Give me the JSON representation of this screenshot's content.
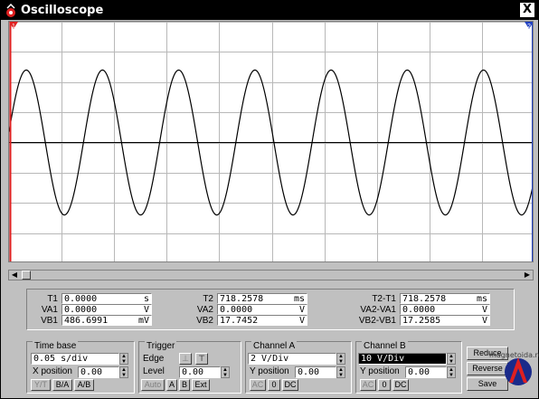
{
  "window": {
    "title": "Oscilloscope",
    "close_label": "X"
  },
  "cursors": {
    "c1": "1",
    "c2": "2"
  },
  "readout": {
    "g1": [
      {
        "label": "T1",
        "value": "0.0000",
        "unit": "s"
      },
      {
        "label": "VA1",
        "value": "0.0000",
        "unit": "V"
      },
      {
        "label": "VB1",
        "value": "486.6991",
        "unit": "mV"
      }
    ],
    "g2": [
      {
        "label": "T2",
        "value": "718.2578",
        "unit": "ms"
      },
      {
        "label": "VA2",
        "value": "0.0000",
        "unit": "V"
      },
      {
        "label": "VB2",
        "value": "17.7452",
        "unit": "V"
      }
    ],
    "g3": [
      {
        "label": "T2-T1",
        "value": "718.2578",
        "unit": "ms"
      },
      {
        "label": "VA2-VA1",
        "value": "0.0000",
        "unit": "V"
      },
      {
        "label": "VB2-VB1",
        "value": "17.2585",
        "unit": "V"
      }
    ]
  },
  "timebase": {
    "title": "Time base",
    "scale": "0.05 s/div",
    "xpos_label": "X position",
    "xpos": "0.00",
    "btn_yt": "Y/T",
    "btn_ba": "B/A",
    "btn_ab": "A/B"
  },
  "trigger": {
    "title": "Trigger",
    "edge_label": "Edge",
    "level_label": "Level",
    "level": "0.00",
    "btn_auto": "Auto",
    "btn_a": "A",
    "btn_b": "B",
    "btn_ext": "Ext"
  },
  "channel_a": {
    "title": "Channel A",
    "scale": "2 V/Div",
    "ypos_label": "Y position",
    "ypos": "0.00",
    "btn_ac": "AC",
    "btn_0": "0",
    "btn_dc": "DC"
  },
  "channel_b": {
    "title": "Channel B",
    "scale": "10 V/Div",
    "ypos_label": "Y position",
    "ypos": "0.00",
    "btn_ac": "AC",
    "btn_0": "0",
    "btn_dc": "DC"
  },
  "side_buttons": {
    "reduce": "Reduce",
    "reverse": "Reverse",
    "save": "Save"
  },
  "watermark": "magnetoida.ru",
  "chart_data": {
    "type": "line",
    "series": [
      {
        "waveform": "sine",
        "cycles": 7
      }
    ],
    "grid": true
  }
}
